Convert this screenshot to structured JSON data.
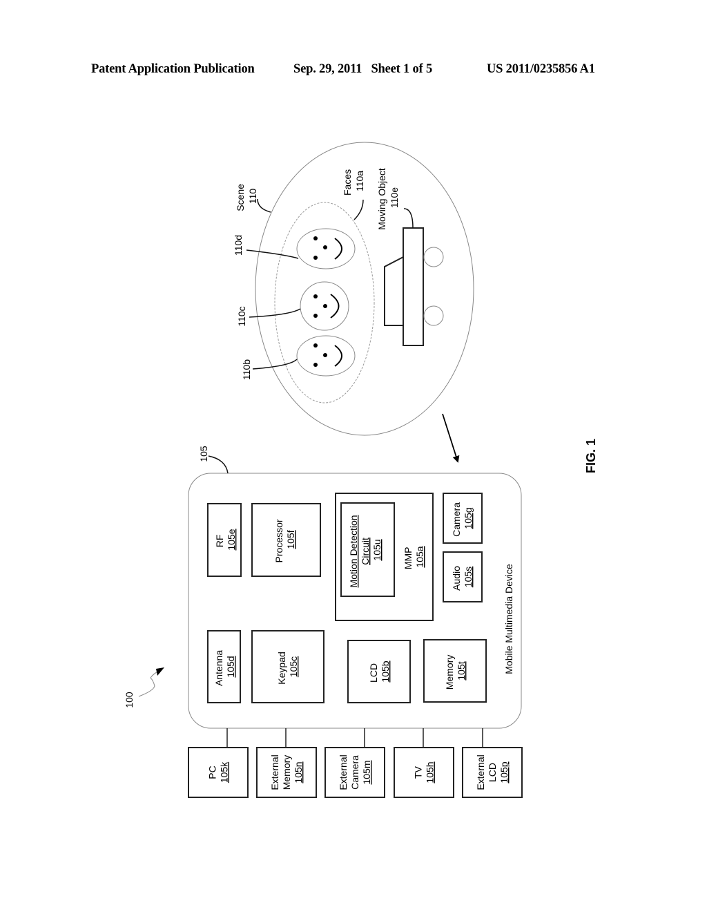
{
  "header": {
    "publication": "Patent Application Publication",
    "date_sheet": "Sep. 29, 2011   Sheet 1 of 5",
    "number": "US 2011/0235856 A1"
  },
  "figure": {
    "label": "FIG. 1",
    "system_ref": "100",
    "device": {
      "ref": "105",
      "title": "Mobile Multimedia Device",
      "components": {
        "rf": {
          "name": "RF",
          "ref": "105e"
        },
        "processor": {
          "name": "Processor",
          "ref": "105f"
        },
        "antenna": {
          "name": "Antenna",
          "ref": "105d"
        },
        "keypad": {
          "name": "Keypad",
          "ref": "105c"
        },
        "mmp": {
          "name": "MMP",
          "ref": "105a"
        },
        "motion": {
          "name_line1": "Motion Detection",
          "name_line2": "Circuit",
          "ref": "105u"
        },
        "lcd": {
          "name": "LCD",
          "ref": "105b"
        },
        "camera": {
          "name": "Camera",
          "ref": "105g"
        },
        "audio": {
          "name": "Audio",
          "ref": "105s"
        },
        "memory": {
          "name": "Memory",
          "ref": "105t"
        }
      }
    },
    "peripherals": [
      {
        "line1": "PC",
        "line2": "",
        "ref": "105k"
      },
      {
        "line1": "External",
        "line2": "Memory",
        "ref": "105n"
      },
      {
        "line1": "External",
        "line2": "Camera",
        "ref": "105m"
      },
      {
        "line1": "TV",
        "line2": "",
        "ref": "105h"
      },
      {
        "line1": "External",
        "line2": "LCD",
        "ref": "105p"
      }
    ],
    "scene": {
      "name": "Scene",
      "ref": "110",
      "faces_group": {
        "name": "Faces",
        "ref": "110a"
      },
      "faces": [
        "110b",
        "110c",
        "110d"
      ],
      "moving_object": {
        "name": "Moving Object",
        "ref": "110e"
      }
    }
  }
}
